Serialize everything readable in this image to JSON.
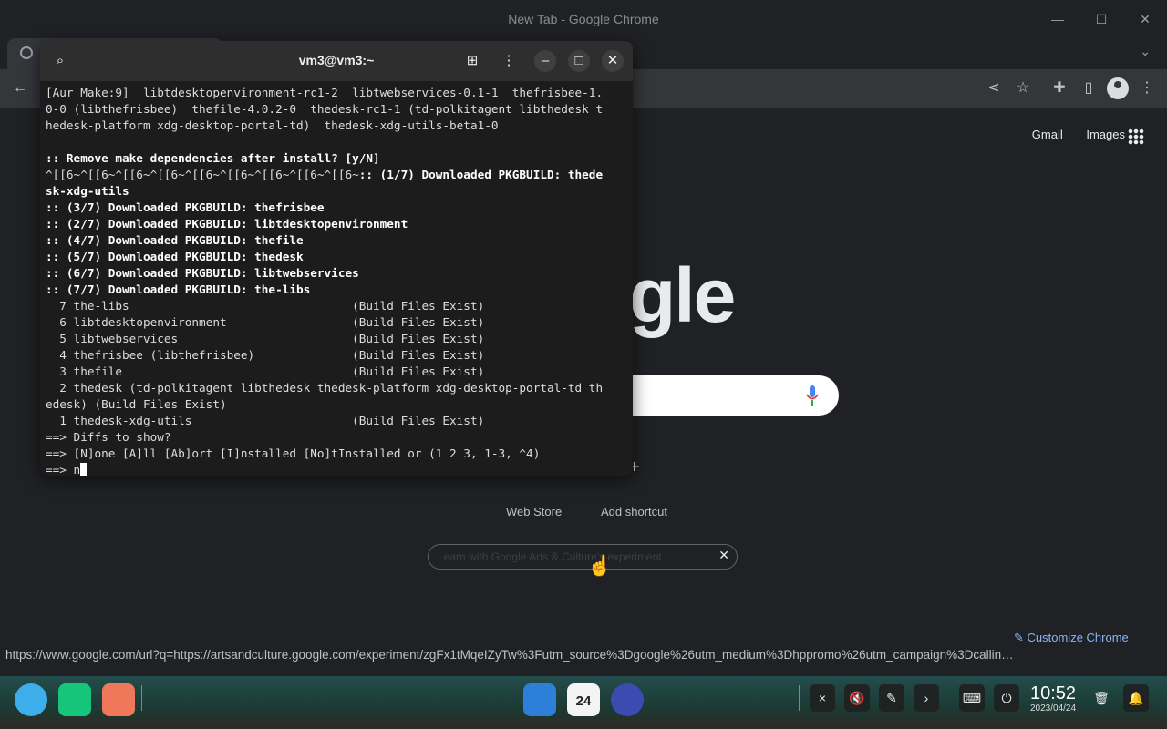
{
  "chrome": {
    "window_title": "New Tab - Google Chrome",
    "top_links": [
      "Gmail",
      "Images"
    ],
    "logo_fragment": "gle",
    "shortcuts": [
      "Web Store",
      "Add shortcut"
    ],
    "promo_text": "Learn with Google Arts & Culture's experiment",
    "customize_label": "Customize Chrome",
    "status_url": "https://www.google.com/url?q=https://artsandculture.google.com/experiment/zgFx1tMqeIZyTw%3Futm_source%3Dgoogle%26utm_medium%3Dhppromo%26utm_campaign%3Dcallin…"
  },
  "terminal": {
    "title": "vm3@vm3:~",
    "lines": [
      {
        "text": "[Aur Make:9]  libtdesktopenvironment-rc1-2  libtwebservices-0.1-1  thefrisbee-1.",
        "bold": false
      },
      {
        "text": "0-0 (libthefrisbee)  thefile-4.0.2-0  thedesk-rc1-1 (td-polkitagent libthedesk t",
        "bold": false
      },
      {
        "text": "hedesk-platform xdg-desktop-portal-td)  thedesk-xdg-utils-beta1-0",
        "bold": false
      },
      {
        "text": "",
        "bold": false
      },
      {
        "text": ":: Remove make dependencies after install? [y/N]",
        "bold": true
      },
      {
        "text": "^[[6~^[[6~^[[6~^[[6~^[[6~^[[6~^[[6~^[[6~^[[6~:: (1/7) Downloaded PKGBUILD: thede",
        "bold": "partial"
      },
      {
        "text": "sk-xdg-utils",
        "bold": true
      },
      {
        "text": ":: (3/7) Downloaded PKGBUILD: thefrisbee",
        "bold": true
      },
      {
        "text": ":: (2/7) Downloaded PKGBUILD: libtdesktopenvironment",
        "bold": true
      },
      {
        "text": ":: (4/7) Downloaded PKGBUILD: thefile",
        "bold": true
      },
      {
        "text": ":: (5/7) Downloaded PKGBUILD: thedesk",
        "bold": true
      },
      {
        "text": ":: (6/7) Downloaded PKGBUILD: libtwebservices",
        "bold": true
      },
      {
        "text": ":: (7/7) Downloaded PKGBUILD: the-libs",
        "bold": true
      },
      {
        "text": "  7 the-libs                                (Build Files Exist)",
        "bold": false
      },
      {
        "text": "  6 libtdesktopenvironment                  (Build Files Exist)",
        "bold": false
      },
      {
        "text": "  5 libtwebservices                         (Build Files Exist)",
        "bold": false
      },
      {
        "text": "  4 thefrisbee (libthefrisbee)              (Build Files Exist)",
        "bold": false
      },
      {
        "text": "  3 thefile                                 (Build Files Exist)",
        "bold": false
      },
      {
        "text": "  2 thedesk (td-polkitagent libthedesk thedesk-platform xdg-desktop-portal-td th",
        "bold": false
      },
      {
        "text": "edesk) (Build Files Exist)",
        "bold": false
      },
      {
        "text": "  1 thedesk-xdg-utils                       (Build Files Exist)",
        "bold": false
      },
      {
        "text": "==> Diffs to show?",
        "bold": false
      },
      {
        "text": "==> [N]one [A]ll [Ab]ort [I]nstalled [No]tInstalled or (1 2 3, 1-3, ^4)",
        "bold": false
      }
    ],
    "prompt": "==> n"
  },
  "taskbar": {
    "clock_time": "10:52",
    "clock_date": "2023/04/24",
    "calendar_day": "24"
  }
}
